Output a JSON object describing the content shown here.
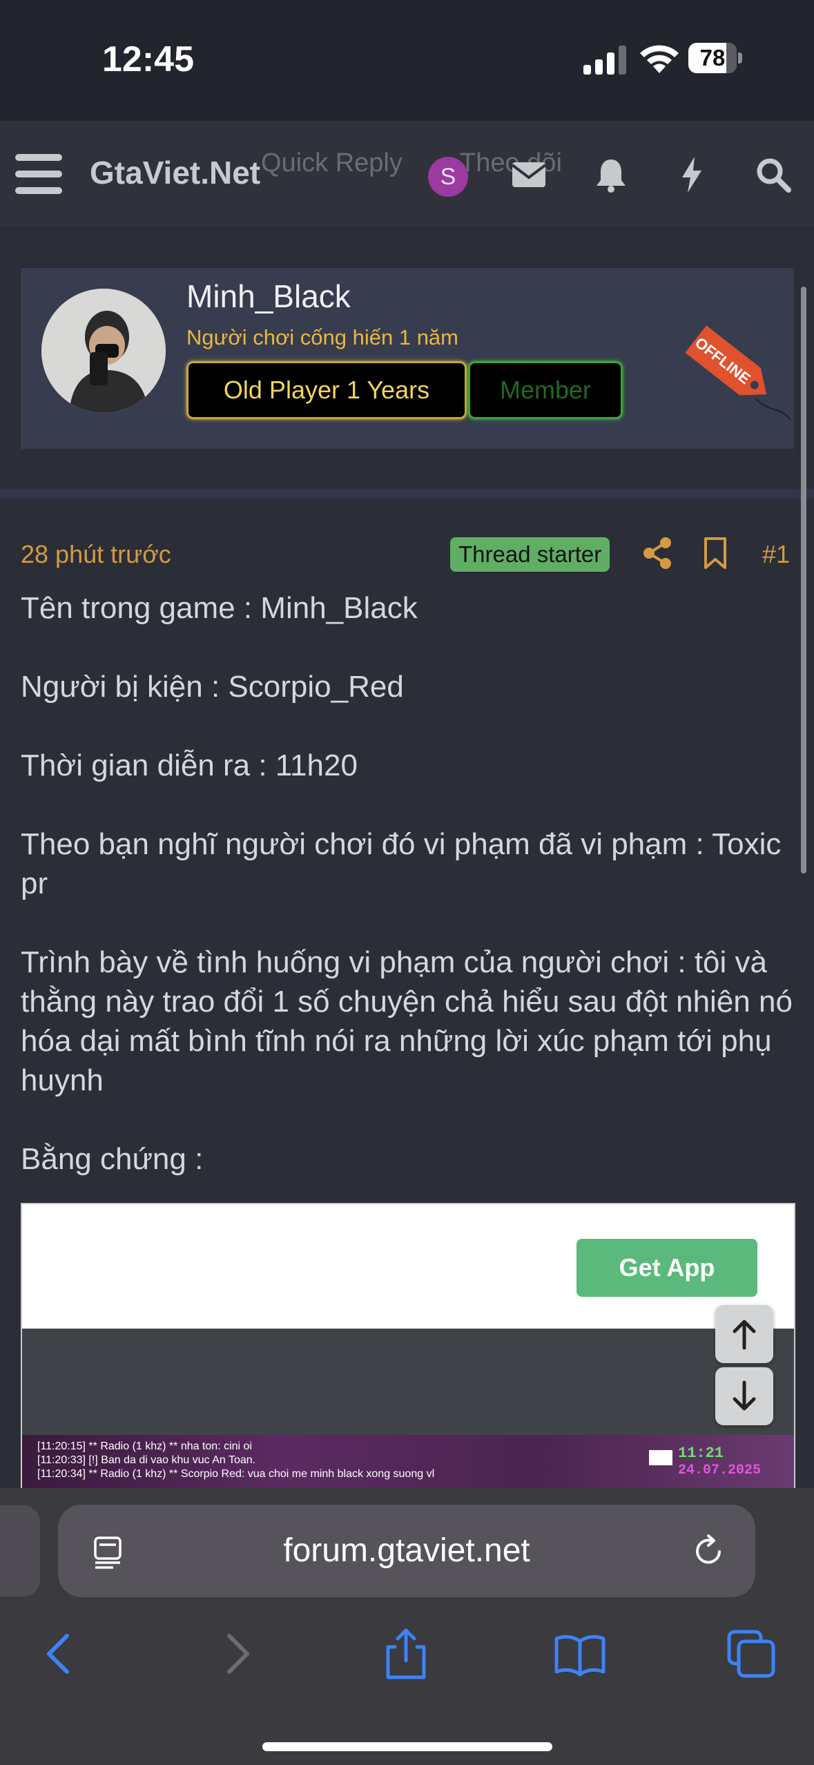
{
  "status_bar": {
    "time": "12:45",
    "battery_level": "78",
    "battery_fraction": 0.78
  },
  "navbar": {
    "site_title": "GtaViet.Net",
    "ghost_quick_reply": "Quick Reply",
    "ghost_watch": "Theo dõi",
    "user_initial": "S",
    "icons": [
      "menu-icon",
      "mail-icon",
      "bell-icon",
      "bolt-icon",
      "search-icon"
    ]
  },
  "profile": {
    "name": "Minh_Black",
    "tagline": "Người chơi cống hiến 1 năm",
    "badge_primary": "Old Player 1 Years",
    "badge_secondary": "Member",
    "status_tag": "OFFLINE"
  },
  "post": {
    "time": "28 phút trước",
    "starter_label": "Thread starter",
    "number": "#1",
    "paragraphs": [
      "Tên trong game : Minh_Black",
      "Người bị kiện : Scorpio_Red",
      "Thời gian diễn ra : 11h20",
      "Theo bạn nghĩ người chơi đó vi phạm đã vi phạm : Toxic pr",
      "Trình bày về tình huống vi phạm của người chơi : tôi và thằng này trao đổi 1 số chuyện chả hiểu sau đột nhiên nó hóa dại mất bình tĩnh nói ra những lời xúc phạm tới phụ huynh",
      "Bằng chứng :"
    ]
  },
  "embed": {
    "get_app_label": "Get App",
    "chat_lines": [
      "[11:20:15] ** Radio (1 khz) ** nha ton: cini oi",
      "[11:20:33] [!] Ban da di vao khu vuc An Toan.",
      "[11:20:34] ** Radio (1 khz) ** Scorpio Red: vua choi me minh black xong suong vl"
    ],
    "clock": "11:21",
    "date": "24.07.2025"
  },
  "safari": {
    "address": "forum.gtaviet.net"
  },
  "colors": {
    "accent_orange": "#d39a43",
    "gold": "#e8b93c",
    "green_badge": "#5fae64",
    "ios_blue": "#3d82f6"
  }
}
